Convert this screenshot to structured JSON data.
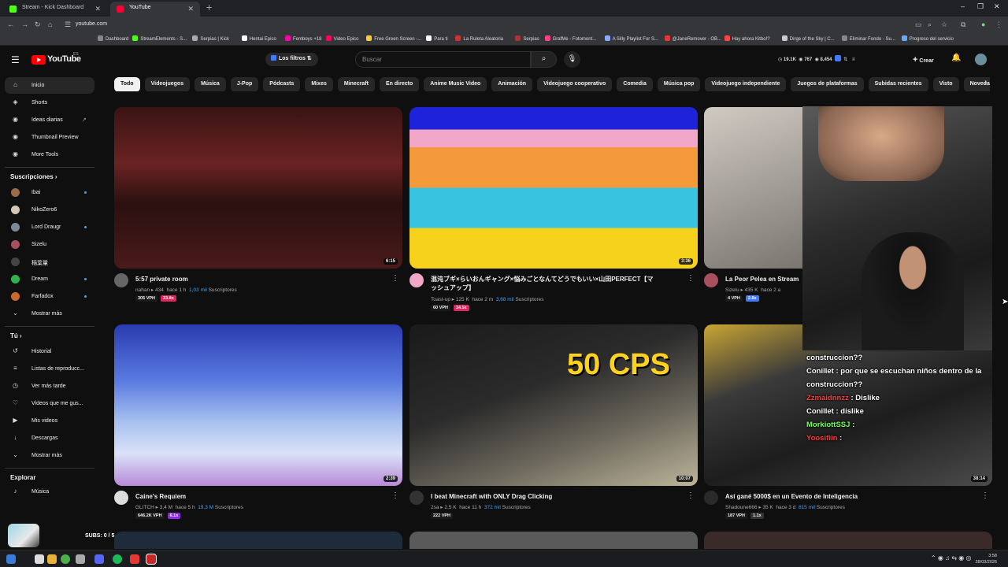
{
  "browser": {
    "tabs": [
      {
        "title": "Stream - Kick Dashboard",
        "color": "#53fc18"
      },
      {
        "title": "YouTube",
        "color": "#ff0033"
      }
    ],
    "url": "youtube.com",
    "bookmarks": [
      "Dashboard",
      "StreamElements - S...",
      "Serpias | Kick",
      "Hentai Epico",
      "Femboys +18",
      "Video Epico",
      "Free Green Screen -...",
      "Para ti",
      "La Ruleta Aleatoria",
      "Serpias",
      "GrafMe - Fotomont...",
      "A Silly Playlist For S...",
      "@JaneRemover - OB...",
      "Hay ahora Kitbo!?",
      "Dirge of the Sky | C...",
      "Eliminar Fondo - Su...",
      "Progreso del servicio"
    ]
  },
  "header": {
    "logo_text": "YouTube",
    "logo_country": "ES",
    "filters_label": "Los filtros",
    "search_placeholder": "Buscar",
    "stat_views": "19.1K",
    "stat_likes": "767",
    "stat_subs": "8,454",
    "create_label": "Crear",
    "icons": {
      "menu": "hamburger-icon",
      "search": "magnifier-icon",
      "mic": "microphone-icon",
      "bell": "bell-icon"
    }
  },
  "sidebar": {
    "main": [
      {
        "label": "Inicio",
        "icon": "⌂",
        "selected": true
      },
      {
        "label": "Shorts",
        "icon": "◈"
      },
      {
        "label": "Ideas diarias",
        "icon": "◉",
        "extra": "↗"
      },
      {
        "label": "Thumbnail Preview",
        "icon": "◉"
      },
      {
        "label": "More Tools",
        "icon": "◉"
      }
    ],
    "subs_header": "Suscripciones",
    "subscriptions": [
      {
        "label": "Ibai",
        "color": "#9b6b4a",
        "dot": true
      },
      {
        "label": "NikoZero6",
        "color": "#d4c7b8",
        "dot": false
      },
      {
        "label": "Lord Draugr",
        "color": "#7a8a99",
        "dot": true
      },
      {
        "label": "Sizelu",
        "color": "#a85060",
        "dot": false
      },
      {
        "label": "稲葉量",
        "color": "#444444",
        "dot": false
      },
      {
        "label": "Dream",
        "color": "#2fb34a",
        "dot": true
      },
      {
        "label": "Farfadox",
        "color": "#c96a2a",
        "dot": true
      }
    ],
    "show_more": "Mostrar más",
    "you_header": "Tú",
    "you": [
      {
        "label": "Historial",
        "icon": "↺"
      },
      {
        "label": "Listas de reproducc...",
        "icon": "≡"
      },
      {
        "label": "Ver más tarde",
        "icon": "◷"
      },
      {
        "label": "Videos que me gus...",
        "icon": "♡"
      },
      {
        "label": "Mis videos",
        "icon": "▶"
      },
      {
        "label": "Descargas",
        "icon": "↓"
      }
    ],
    "show_more_2": "Mostrar más",
    "explore_header": "Explorar",
    "explore": [
      {
        "label": "Música",
        "icon": "♪"
      }
    ],
    "overlay_subs": "SUBS: 0 / 5"
  },
  "chips": [
    "Todo",
    "Videojuegos",
    "Música",
    "J-Pop",
    "Pódcasts",
    "Mixes",
    "Minecraft",
    "En directo",
    "Anime Music Video",
    "Animación",
    "Videojuego cooperativo",
    "Comedia",
    "Música pop",
    "Videojuego independiente",
    "Juegos de plataformas",
    "Subidas recientes",
    "Visto",
    "Novedad"
  ],
  "videos": [
    {
      "title": "5:57 private room",
      "title2": "",
      "channel": "nahan",
      "views": "434",
      "age": "hace 1 h",
      "subs": "1,03 mil",
      "subs_label": "Suscriptores",
      "vph": "305 VPH",
      "mult": "33.8x",
      "mult_color": "#e0245e",
      "duration": "6:15",
      "bg": "linear-gradient(180deg,#3a1414 0%,#6b2222 35%,#2a1010 60%,#4a1a1a 100%)",
      "av": "#666"
    },
    {
      "title": "混沌ブギ×らいおんギャング×悩みごとなんてどうでもいい×山田PERFECT【マ",
      "title2": "ッシュアップ】",
      "channel": "Toast-up",
      "views": "125 K",
      "age": "hace 2 m",
      "subs": "3,68 mil",
      "subs_label": "Suscriptores",
      "vph": "60 VPH",
      "mult": "14.5x",
      "mult_color": "#e0245e",
      "duration": "3:36",
      "bg": "linear-gradient(180deg,#1e22d8 0 14%,#f2a7c9 14% 25%,#f49a3a 25% 50%,#37c4e0 50% 75%,#f7d21c 75% 100%)",
      "av": "#f2a7c9"
    },
    {
      "title": "La Peor Pelea en Stream",
      "title2": "",
      "channel": "Sizelu",
      "views": "435 K",
      "age": "hace 2 a",
      "subs": "",
      "subs_label": "",
      "vph": "4 VPH",
      "mult": "2.8x",
      "mult_color": "#3e7bff",
      "duration": "",
      "bg": "linear-gradient(160deg,#cfcac2,#8b8680 60%,#5a5650)",
      "av": "#a85060"
    },
    {
      "title": "Caine's Requiem",
      "title2": "",
      "channel": "GLITCH",
      "views": "3,4 M",
      "age": "hace 5 h",
      "subs": "19,3 M",
      "subs_label": "Suscriptores",
      "vph": "646.2K VPH",
      "mult": "6.1x",
      "mult_color": "#8a2be2",
      "duration": "2:39",
      "bg": "linear-gradient(180deg,#2a3bb0 0%,#5a7be0 35%,#a7c0f0 60%,#d9e2f7 80%,#b88ad8 100%)",
      "av": "#ddd"
    },
    {
      "title": "I beat Minecraft with ONLY Drag Clicking",
      "title2": "",
      "channel": "2sa",
      "views": "2,5 K",
      "age": "hace 11 h",
      "subs": "372 mil",
      "subs_label": "Suscriptores",
      "vph": "222 VPH",
      "mult": "",
      "mult_color": "",
      "duration": "10:07",
      "bg": "linear-gradient(160deg,#1a1a1a 0%,#2b2b2b 40%,#6e6a5e 70%,#bdb59a 100%)",
      "av": "#333",
      "overlay": "50 CPS"
    },
    {
      "title": "Así gané 5000$ en un Evento de Inteligencia",
      "title2": "",
      "channel": "Shadoune666",
      "views": "35 K",
      "age": "hace 3 d",
      "subs": "815 mil",
      "subs_label": "Suscriptores",
      "vph": "187 VPH",
      "mult": "1.1x",
      "mult_color": "#333",
      "duration": "38:14",
      "bg": "linear-gradient(160deg,#c9a533 0%,#3a3a3a 30%,#1d1d1d 60%,#4b4b4b 100%)",
      "av": "#2a2a2a"
    }
  ],
  "chat": [
    {
      "user": "",
      "text": "construccion??"
    },
    {
      "user": "Conillet",
      "text": ": por que se escuchan niños dentro de la construccion??"
    },
    {
      "user": "Zzmaidnnzz",
      "text": ": Dislike",
      "userColor": "red"
    },
    {
      "user": "Conillet",
      "text": ": dislike"
    },
    {
      "user": "MorkiottSSJ",
      "text": ":",
      "userColor": "grn"
    },
    {
      "user": "Yoosifiin",
      "text": ":",
      "userColor": "red"
    }
  ],
  "taskbar": {
    "time": "3:58",
    "date": "28/03/2026"
  }
}
